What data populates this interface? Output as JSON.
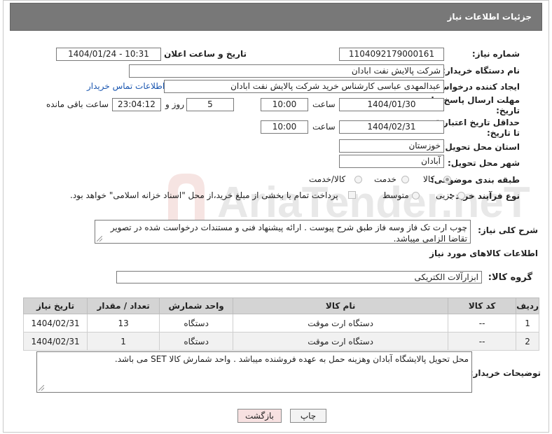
{
  "header": {
    "title": "جزئیات اطلاعات نیاز"
  },
  "form": {
    "need_number_label": "شماره نیاز:",
    "need_number": "1104092179000161",
    "announce_label": "تاریخ و ساعت اعلان عمومی:",
    "announce_value": "1404/01/24 - 10:31",
    "buyer_org_label": "نام دستگاه خریدار:",
    "buyer_org": "شرکت پالایش نفت ابادان",
    "creator_label": "ایجاد کننده درخواست:",
    "creator": "عبدالمهدی  عباسی کارشناس خرید شرکت پالایش نفت ابادان",
    "contact_link": "اطلاعات تماس خریدار",
    "reply_deadline_label_1": "مهلت ارسال پاسخ: تا",
    "reply_deadline_label_2": "تاریخ:",
    "reply_date": "1404/01/30",
    "time_label": "ساعت",
    "reply_time": "10:00",
    "days_value": "5",
    "days_label": "روز و",
    "remaining_value": "23:04:12",
    "remaining_label": "ساعت باقی مانده",
    "price_validity_label_1": "حداقل تاریخ اعتبار قیمت:",
    "price_validity_label_2": "تا تاریخ:",
    "price_date": "1404/02/31",
    "price_time": "10:00",
    "province_label": "استان محل تحویل:",
    "province": "خوزستان",
    "city_label": "شهر محل تحویل:",
    "city": "آبادان",
    "category_label": "طبقه بندی موضوعی:",
    "category_options": [
      "کالا",
      "خدمت",
      "کالا/خدمت"
    ],
    "process_label": "نوع فرآیند خرید :",
    "process_options": [
      "جزیی",
      "متوسط"
    ],
    "payment_note": "پرداخت تمام یا بخشی از مبلغ خرید،از محل \"اسناد خزانه اسلامی\" خواهد بود.",
    "description_label": "شرح کلی نیاز:",
    "description": "چوب ارت تک فاز وسه فاز طبق شرح پیوست . ارائه پیشنهاد فنی و مستندات درخواست شده در تصویر تقاضا الزامی میباشد.",
    "goods_info_title": "اطلاعات کالاهای مورد نیاز",
    "goods_group_label": "گروه کالا:",
    "goods_group": "ابزارآلات الکتریکی"
  },
  "table": {
    "headers": [
      "ردیف",
      "کد کالا",
      "نام کالا",
      "واحد شمارش",
      "تعداد / مقدار",
      "تاریخ نیاز"
    ],
    "rows": [
      [
        "1",
        "--",
        "دستگاه ارت موقت",
        "دستگاه",
        "13",
        "1404/02/31"
      ],
      [
        "2",
        "--",
        "دستگاه ارت موقت",
        "دستگاه",
        "1",
        "1404/02/31"
      ]
    ]
  },
  "buyer_notes_label": "توضیحات خریدار:",
  "buyer_notes": "محل تحویل پالایشگاه آبادان وهزینه حمل به عهده فروشنده میباشد . واحد شمارش کالا SET می باشد.",
  "buttons": {
    "print": "چاپ",
    "back": "بازگشت"
  },
  "watermark_text": "AriaTender.neT",
  "colors": {
    "header_bg": "#787878",
    "link": "#1a56b0",
    "back_button_bg": "#f7e1e1",
    "table_header_bg": "#d4d4d4"
  }
}
